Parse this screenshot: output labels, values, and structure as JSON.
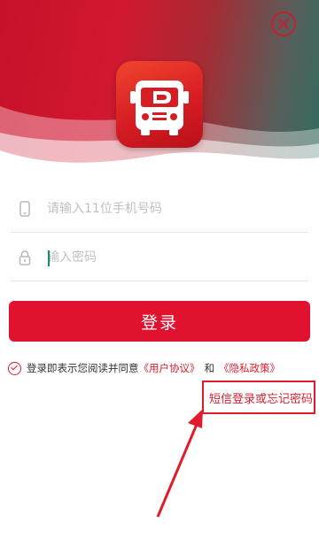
{
  "login": {
    "phone_placeholder": "请输入11位手机号码",
    "password_placeholder": "输入密码",
    "login_button": "登录"
  },
  "agreement": {
    "prefix": "登录即表示您阅读并同意",
    "user_agreement": "《用户协议》",
    "and": "和",
    "privacy_policy": "《隐私政策》"
  },
  "sms_link": "短信登录或忘记密码",
  "icons": {
    "close": "close-icon",
    "logo": "bus-logo-icon",
    "phone": "phone-icon",
    "lock": "lock-icon",
    "check": "check-circle-icon"
  },
  "colors": {
    "brand_red": "#e0122e",
    "link_red": "#d6202f",
    "header_teal": "#2f6b60"
  }
}
